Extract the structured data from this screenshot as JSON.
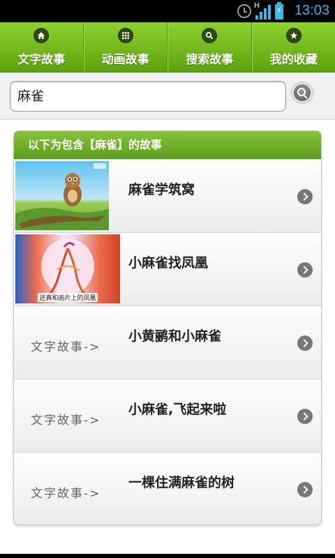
{
  "status": {
    "time": "13:03",
    "network_type": "H",
    "accent": "#39b5e8"
  },
  "tabs": [
    {
      "label": "文字故事",
      "icon": "home-icon"
    },
    {
      "label": "动画故事",
      "icon": "grid-icon"
    },
    {
      "label": "搜索故事",
      "icon": "search-icon"
    },
    {
      "label": "我的收藏",
      "icon": "star-icon"
    }
  ],
  "search": {
    "value": "麻雀"
  },
  "results": {
    "header": "以下为包含【麻雀】的故事",
    "placeholder_label": "文字故事->",
    "items": [
      {
        "title": "麻雀学筑窝",
        "thumb": "sparrow"
      },
      {
        "title": "小麻雀找凤凰",
        "thumb": "phoenix",
        "thumb_caption": "还真和画片上的凤凰"
      },
      {
        "title": "小黄鹂和小麻雀",
        "thumb": "text"
      },
      {
        "title": "小麻雀,飞起来啦",
        "thumb": "text"
      },
      {
        "title": "一棵住满麻雀的树",
        "thumb": "text"
      }
    ]
  },
  "colors": {
    "nav_green_top": "#8fd12e",
    "nav_green_bottom": "#5da20e",
    "header_green": "#6aab24"
  }
}
